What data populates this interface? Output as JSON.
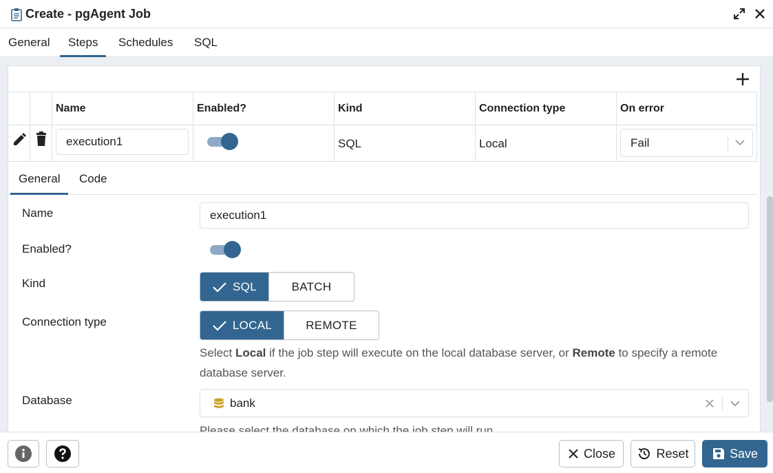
{
  "dialog": {
    "title": "Create - pgAgent Job",
    "icon": "clipboard-icon"
  },
  "tabs": [
    {
      "label": "General"
    },
    {
      "label": "Steps",
      "active": true
    },
    {
      "label": "Schedules"
    },
    {
      "label": "SQL"
    }
  ],
  "steps_grid": {
    "columns": [
      "Name",
      "Enabled?",
      "Kind",
      "Connection type",
      "On error"
    ],
    "rows": [
      {
        "name": "execution1",
        "enabled": true,
        "kind": "SQL",
        "connection_type": "Local",
        "on_error": "Fail"
      }
    ]
  },
  "step_editor": {
    "tabs": [
      {
        "label": "General",
        "active": true
      },
      {
        "label": "Code"
      }
    ],
    "fields": {
      "name_label": "Name",
      "name_value": "execution1",
      "enabled_label": "Enabled?",
      "kind_label": "Kind",
      "kind_options": [
        "SQL",
        "BATCH"
      ],
      "connection_label": "Connection type",
      "connection_options": [
        "LOCAL",
        "REMOTE"
      ],
      "connection_help": {
        "part1": "Select ",
        "bold1": "Local",
        "part2": " if the job step will execute on the local database server, or ",
        "bold2": "Remote",
        "part3": " to specify a remote database server."
      },
      "database_label": "Database",
      "database_value": "bank",
      "database_help": "Please select the database on which the job step will run."
    }
  },
  "footer": {
    "close_label": "Close",
    "reset_label": "Reset",
    "save_label": "Save"
  },
  "colors": {
    "accent": "#326690",
    "toggle_track": "#8ea9c4",
    "border": "#dde0e6",
    "background": "#ebeef3",
    "database_icon": "#c9a227"
  }
}
